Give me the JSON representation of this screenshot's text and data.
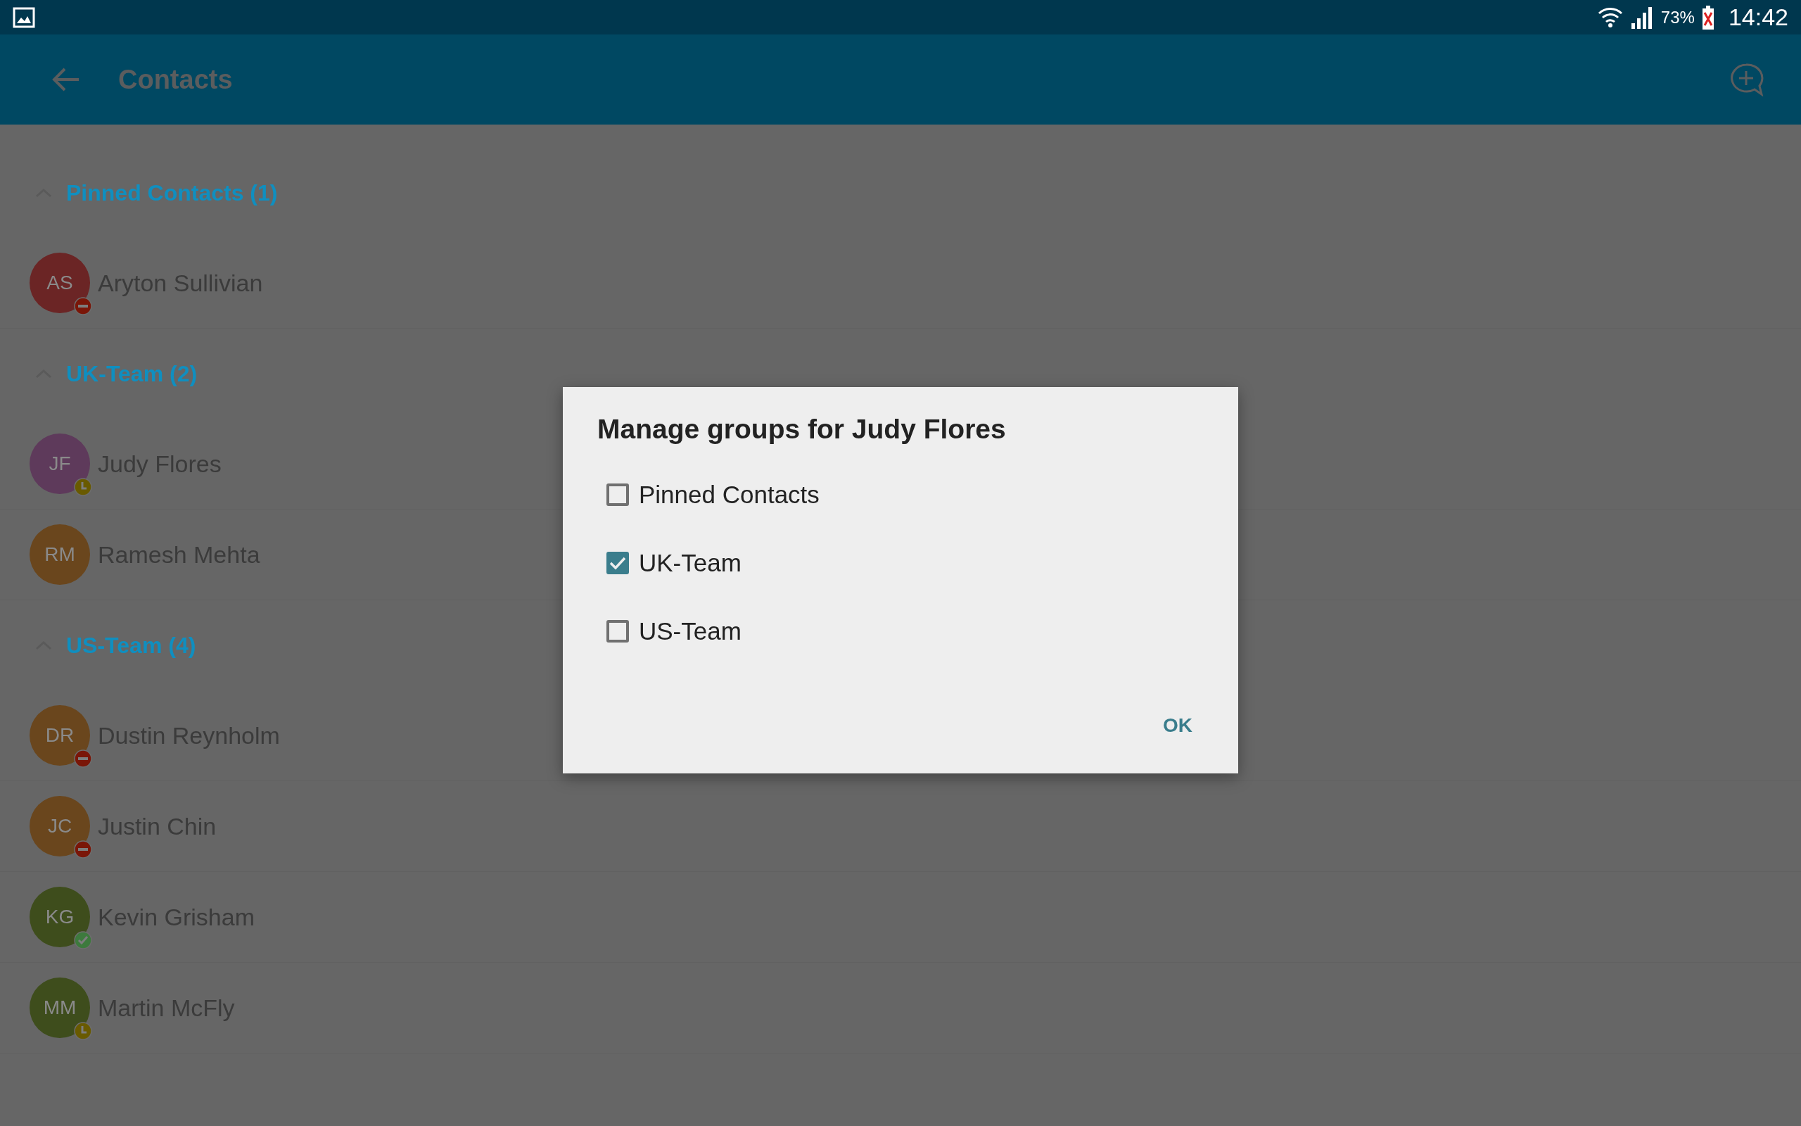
{
  "status_bar": {
    "battery": "73%",
    "time": "14:42"
  },
  "app_bar": {
    "title": "Contacts"
  },
  "sections": [
    {
      "title": "Pinned Contacts (1)",
      "expanded": true,
      "contacts": [
        {
          "initials": "AS",
          "name": "Aryton Sullivian",
          "color": "#6b2525",
          "kind": "busy"
        }
      ]
    },
    {
      "title": "UK-Team (2)",
      "expanded": true,
      "contacts": [
        {
          "initials": "JF",
          "name": "Judy Flores",
          "color": "#5e3a5b",
          "kind": "away"
        },
        {
          "initials": "RM",
          "name": "Ramesh Mehta",
          "color": "#6a461d",
          "kind": "plain"
        }
      ]
    },
    {
      "title": "US-Team (4)",
      "expanded": true,
      "contacts": [
        {
          "initials": "DR",
          "name": "Dustin Reynholm",
          "color": "#6a461d",
          "kind": "busy"
        },
        {
          "initials": "JC",
          "name": "Justin Chin",
          "color": "#6a461d",
          "kind": "busy"
        },
        {
          "initials": "KG",
          "name": "Kevin Grisham",
          "color": "#3e4d1c",
          "kind": "available"
        },
        {
          "initials": "MM",
          "name": "Martin McFly",
          "color": "#3e4d1c",
          "kind": "away"
        }
      ]
    }
  ],
  "dialog": {
    "title": "Manage groups for Judy Flores",
    "options": [
      {
        "label": "Pinned Contacts",
        "checked": false
      },
      {
        "label": "UK-Team",
        "checked": true
      },
      {
        "label": "US-Team",
        "checked": false
      }
    ],
    "button": "OK"
  }
}
